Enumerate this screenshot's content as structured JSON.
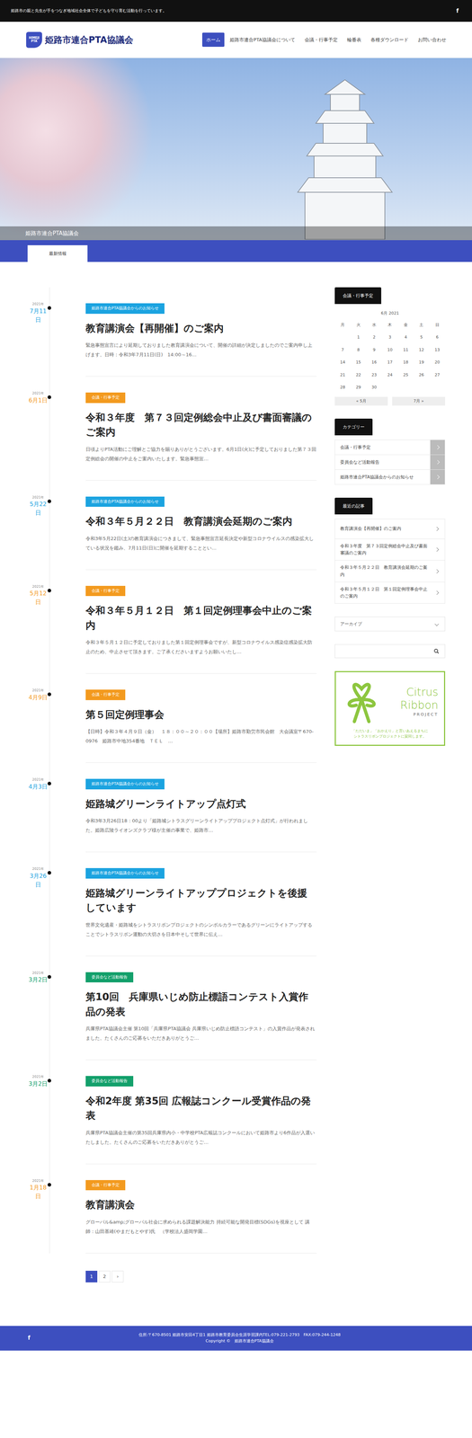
{
  "topbar": {
    "tagline": "姫路市の親と先生が手をつなぎ地域社会全体で子どもを守り育む活動を行っています。",
    "facebook_icon": "f"
  },
  "logo": {
    "mark_top": "HIMEJI",
    "mark_bottom": "PTA",
    "title": "姫路市連合PTA協議会"
  },
  "nav": [
    {
      "label": "ホーム",
      "selected": true
    },
    {
      "label": "姫路市連合PTA協議会について",
      "selected": false
    },
    {
      "label": "会議・行事予定",
      "selected": false
    },
    {
      "label": "輪番表",
      "selected": false
    },
    {
      "label": "各種ダウンロード",
      "selected": false
    },
    {
      "label": "お問い合わせ",
      "selected": false
    }
  ],
  "hero": {
    "caption": "姫路市連合PTA協議会"
  },
  "section_tab": "最新情報",
  "posts": [
    {
      "year": "2021年",
      "date": "7月11日",
      "category": "姫路市連合PTA協議会からのお知らせ",
      "color": "#1ba3e0",
      "title": "教育講演会【再開催】のご案内",
      "excerpt": "緊急事態宣言により延期しておりました教育講演会について、開催の詳細が決定しましたのでご案内申し上げます。日時：令和3年7月11日(日)　14:00～16…"
    },
    {
      "year": "2021年",
      "date": "6月1日",
      "category": "会議・行事予定",
      "color": "#f39a1e",
      "title": "令和３年度　第７３回定例総会中止及び書面審議のご案内",
      "excerpt": "日頃よりPTA活動にご理解とご協力を賜りありがとうございます。6月1日(火)に予定しておりました第７３回定例総会の開催の中止をご案内いたします。緊急事態宣…"
    },
    {
      "year": "2021年",
      "date": "5月22日",
      "category": "姫路市連合PTA協議会からのお知らせ",
      "color": "#1ba3e0",
      "title": "令和３年５月２２日　教育講演会延期のご案内",
      "excerpt": "令和3年5月22日(土)の教育講演会につきまして、緊急事態宣言延長決定や新型コロナウイルスの感染拡大している状況を鑑み、7月11日(日)に開催を延期することとい…"
    },
    {
      "year": "2021年",
      "date": "5月12日",
      "category": "会議・行事予定",
      "color": "#f39a1e",
      "title": "令和３年５月１２日　第１回定例理事会中止のご案内",
      "excerpt": "令和３年５月１２日に予定しておりました第１回定例理事会ですが、新型コロナウイルス感染症感染拡大防止のため、中止させて頂きます。ご了承くださいますようお願いいたし…"
    },
    {
      "year": "2021年",
      "date": "4月9日",
      "category": "会議・行事予定",
      "color": "#f39a1e",
      "title": "第５回定例理事会",
      "excerpt": "【日時】令和３年４月９日（金）　１８：００～２０：００【場所】姫路市勤労市民会館　大会議室〒670-0976　姫路市中地354番地　ＴＥＬ　…"
    },
    {
      "year": "2021年",
      "date": "4月3日",
      "category": "姫路市連合PTA協議会からのお知らせ",
      "color": "#1ba3e0",
      "title": "姫路城グリーンライトアップ点灯式",
      "excerpt": "令和3年3月26日18：00より「姫路城シトラスグリーンライトアッププロジェクト点灯式」が行われました。姫路広陵ライオンズクラブ様が主催の事業で、姫路市…"
    },
    {
      "year": "2021年",
      "date": "3月26日",
      "category": "姫路市連合PTA協議会からのお知らせ",
      "color": "#1ba3e0",
      "title": "姫路城グリーンライトアッププロジェクトを後援しています",
      "excerpt": "世界文化遺産・姫路城をシトラスリボンプロジェクトのシンボルカラーであるグリーンにライトアップすることでシトラスリボン運動の大切さを日本中そして世界に伝え…"
    },
    {
      "year": "2021年",
      "date": "3月2日",
      "category": "委員会など活動報告",
      "color": "#13a06b",
      "title": "第10回　兵庫県いじめ防止標語コンテスト入賞作品の発表",
      "excerpt": "兵庫県PTA協議会主催 第10回「兵庫県PTA協議会 兵庫県いじめ防止標語コンテスト」の入賞作品が発表されました。たくさんのご応募をいただきありがとうご…"
    },
    {
      "year": "2021年",
      "date": "3月2日",
      "category": "委員会など活動報告",
      "color": "#13a06b",
      "title": "令和2年度 第35回 広報誌コンクール受賞作品の発表",
      "excerpt": "兵庫県PTA協議会主催の第35回兵庫県内小・中学校PTA広報誌コンクールにおいて姫路市より6作品が入選いたしました。たくさんのご応募をいただきありがとうご…"
    },
    {
      "year": "2021年",
      "date": "1月18日",
      "category": "会議・行事予定",
      "color": "#f39a1e",
      "title": "教育講演会",
      "excerpt": "グローバル&amp;グローバル社会に求められる課題解決能力 持続可能な開発目標(SDGs)を視座として 講師：山田基靖(やまだもとやす)氏　（学校法人盛岡学園…"
    }
  ],
  "pagination": [
    {
      "label": "1",
      "selected": true
    },
    {
      "label": "2",
      "selected": false
    },
    {
      "label": "›",
      "selected": false
    }
  ],
  "sidebar": {
    "calendar": {
      "heading": "会議・行事予定",
      "caption": "6月 2021",
      "weekdays": [
        "月",
        "火",
        "水",
        "木",
        "金",
        "土",
        "日"
      ],
      "weeks": [
        [
          "",
          "1",
          "2",
          "3",
          "4",
          "5",
          "6"
        ],
        [
          "7",
          "8",
          "9",
          "10",
          "11",
          "12",
          "13"
        ],
        [
          "14",
          "15",
          "16",
          "17",
          "18",
          "19",
          "20"
        ],
        [
          "21",
          "22",
          "23",
          "24",
          "25",
          "26",
          "27"
        ],
        [
          "28",
          "29",
          "30",
          "",
          "",
          "",
          ""
        ]
      ],
      "prev": "« 5月",
      "next": "7月 »"
    },
    "categories": {
      "heading": "カテゴリー",
      "items": [
        "会議・行事予定",
        "委員会など活動報告",
        "姫路市連合PTA協議会からのお知らせ"
      ]
    },
    "recent": {
      "heading": "最近の記事",
      "items": [
        "教育講演会【再開催】のご案内",
        "令和３年度　第７３回定例総会中止及び書面審議のご案内",
        "令和３年５月２２日　教育講演会延期のご案内",
        "令和３年５月１２日　第１回定例理事会中止のご案内"
      ]
    },
    "archive": {
      "label": "アーカイブ"
    },
    "banner": {
      "line1": "Citrus",
      "line2": "Ribbon",
      "line3": "PROJECT",
      "foot1": "「ただいま」「おかえり」と言いあえるまちに",
      "foot2": "シトラスリボンプロジェクトに賛同します。"
    }
  },
  "footer": {
    "facebook_icon": "f",
    "address": "住所:〒670-8501 姫路市安田4丁目1 姫路市教育委員会生涯学習課内TEL:079-221-2793　FAX:079-244-1248",
    "copyright": "Copyright ©　姫路市連合PTA協議会"
  }
}
